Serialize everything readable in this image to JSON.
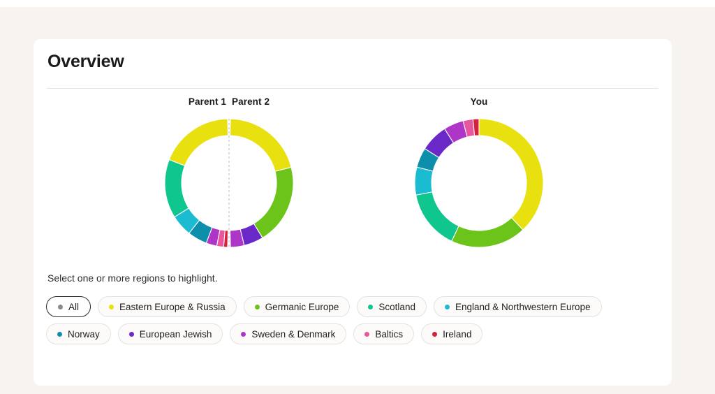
{
  "card": {
    "title": "Overview",
    "prompt": "Select one or more regions to highlight."
  },
  "charts": {
    "parents_label_1": "Parent 1",
    "parents_label_2": "Parent 2",
    "you_label": "You"
  },
  "legend": {
    "all_label": "All",
    "items": [
      {
        "label": "Eastern Europe & Russia",
        "color": "#e9e010"
      },
      {
        "label": "Germanic Europe",
        "color": "#6cc41a"
      },
      {
        "label": "Scotland",
        "color": "#0ec68e"
      },
      {
        "label": "England & Northwestern Europe",
        "color": "#1bbcd2"
      },
      {
        "label": "Norway",
        "color": "#0d8fab"
      },
      {
        "label": "European Jewish",
        "color": "#6a28c8"
      },
      {
        "label": "Sweden & Denmark",
        "color": "#ad35c8"
      },
      {
        "label": "Baltics",
        "color": "#e8569f"
      },
      {
        "label": "Ireland",
        "color": "#d6213a"
      }
    ],
    "all_dot_color": "#8a8a8a"
  },
  "chart_data": {
    "type": "pie",
    "title": "Overview",
    "legend_position": "below",
    "charts": [
      {
        "name": "Parent 1",
        "half": "left",
        "note": "Left semicircle of the combined parents donut, read counter-clockwise from top.",
        "categories": [
          "Eastern Europe & Russia",
          "Scotland",
          "England & Northwestern Europe",
          "Norway",
          "Sweden & Denmark",
          "Baltics",
          "Ireland"
        ],
        "values": [
          38,
          30,
          11,
          10,
          5.5,
          3.5,
          2
        ],
        "colors": [
          "#e9e010",
          "#0ec68e",
          "#1bbcd2",
          "#0d8fab",
          "#ad35c8",
          "#e8569f",
          "#d6213a"
        ]
      },
      {
        "name": "Parent 2",
        "half": "right",
        "note": "Right semicircle of the combined parents donut, read clockwise from top.",
        "categories": [
          "Eastern Europe & Russia",
          "Germanic Europe",
          "European Jewish",
          "Sweden & Denmark"
        ],
        "values": [
          42,
          41,
          10,
          7
        ],
        "colors": [
          "#e9e010",
          "#6cc41a",
          "#6a28c8",
          "#ad35c8"
        ]
      },
      {
        "name": "You",
        "note": "Full donut, read clockwise from 12 o'clock.",
        "categories": [
          "Eastern Europe & Russia",
          "Germanic Europe",
          "Scotland",
          "England & Northwestern Europe",
          "Norway",
          "European Jewish",
          "Sweden & Denmark",
          "Baltics",
          "Ireland"
        ],
        "values": [
          38,
          19,
          15,
          7,
          5,
          7,
          5,
          2.5,
          1.5
        ],
        "colors": [
          "#e9e010",
          "#6cc41a",
          "#0ec68e",
          "#1bbcd2",
          "#0d8fab",
          "#6a28c8",
          "#ad35c8",
          "#e8569f",
          "#d6213a"
        ]
      }
    ]
  }
}
